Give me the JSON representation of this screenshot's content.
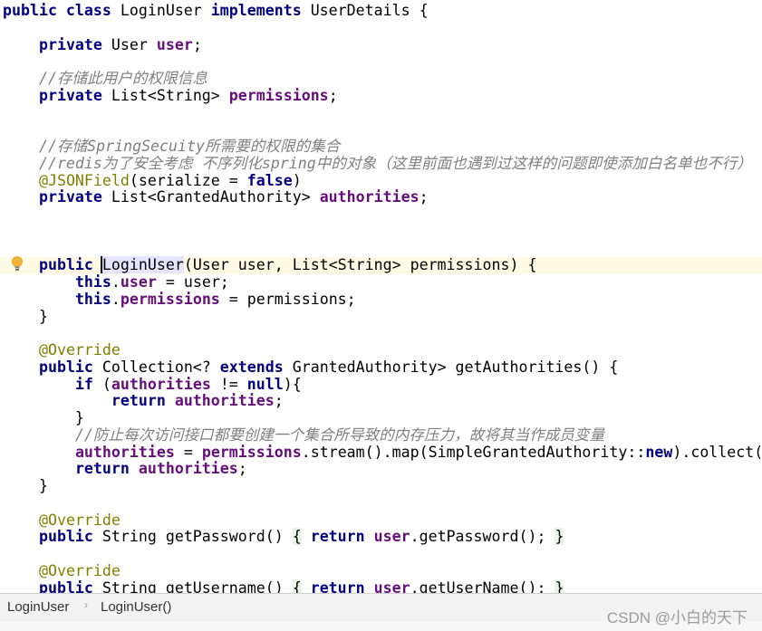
{
  "editor": {
    "current_line": 15,
    "lines": [
      [
        [
          "k",
          "public class "
        ],
        [
          "p",
          "LoginUser "
        ],
        [
          "k",
          "implements "
        ],
        [
          "p",
          "UserDetails {"
        ]
      ],
      [],
      [
        [
          "p",
          "    "
        ],
        [
          "k",
          "private "
        ],
        [
          "p",
          "User "
        ],
        [
          "f",
          "user"
        ],
        [
          "p",
          ";"
        ]
      ],
      [],
      [
        [
          "c",
          "    //存储此用户的权限信息"
        ]
      ],
      [
        [
          "p",
          "    "
        ],
        [
          "k",
          "private "
        ],
        [
          "p",
          "List<String> "
        ],
        [
          "f",
          "permissions"
        ],
        [
          "p",
          ";"
        ]
      ],
      [],
      [],
      [
        [
          "c",
          "    //存储SpringSecuity所需要的权限的集合"
        ]
      ],
      [
        [
          "c",
          "    //redis为了安全考虑 不序列化spring中的对象（这里前面也遇到过这样的问题即使添加白名单也不行）"
        ]
      ],
      [
        [
          "p",
          "    "
        ],
        [
          "a",
          "@JSONField"
        ],
        [
          "p",
          "(serialize = "
        ],
        [
          "k",
          "false"
        ],
        [
          "p",
          ")"
        ]
      ],
      [
        [
          "p",
          "    "
        ],
        [
          "k",
          "private "
        ],
        [
          "p",
          "List<GrantedAuthority> "
        ],
        [
          "f",
          "authorities"
        ],
        [
          "p",
          ";"
        ]
      ],
      [],
      [],
      [],
      [
        [
          "p",
          "    "
        ],
        [
          "k",
          "public "
        ],
        [
          "hl",
          "LoginUser"
        ],
        [
          "p",
          "(User user, List<String> permissions) {"
        ]
      ],
      [
        [
          "p",
          "        "
        ],
        [
          "k",
          "this"
        ],
        [
          "p",
          "."
        ],
        [
          "f",
          "user"
        ],
        [
          "p",
          " = user;"
        ]
      ],
      [
        [
          "p",
          "        "
        ],
        [
          "k",
          "this"
        ],
        [
          "p",
          "."
        ],
        [
          "f",
          "permissions"
        ],
        [
          "p",
          " = permissions;"
        ]
      ],
      [
        [
          "p",
          "    }"
        ]
      ],
      [],
      [
        [
          "p",
          "    "
        ],
        [
          "a",
          "@Override"
        ]
      ],
      [
        [
          "p",
          "    "
        ],
        [
          "k",
          "public "
        ],
        [
          "p",
          "Collection<? "
        ],
        [
          "k",
          "extends "
        ],
        [
          "p",
          "GrantedAuthority> getAuthorities() {"
        ]
      ],
      [
        [
          "p",
          "        "
        ],
        [
          "k",
          "if "
        ],
        [
          "p",
          "("
        ],
        [
          "f",
          "authorities"
        ],
        [
          "p",
          " != "
        ],
        [
          "k",
          "null"
        ],
        [
          "p",
          "){"
        ]
      ],
      [
        [
          "p",
          "            "
        ],
        [
          "k",
          "return "
        ],
        [
          "f",
          "authorities"
        ],
        [
          "p",
          ";"
        ]
      ],
      [
        [
          "p",
          "        }"
        ]
      ],
      [
        [
          "c",
          "        //防止每次访问接口都要创建一个集合所导致的内存压力，故将其当作成员变量"
        ]
      ],
      [
        [
          "p",
          "        "
        ],
        [
          "f",
          "authorities"
        ],
        [
          "p",
          " = "
        ],
        [
          "f",
          "permissions"
        ],
        [
          "p",
          ".stream().map(SimpleGrantedAuthority::"
        ],
        [
          "k",
          "new"
        ],
        [
          "p",
          ").collect(Collectors.toList());"
        ]
      ],
      [
        [
          "p",
          "        "
        ],
        [
          "k",
          "return "
        ],
        [
          "f",
          "authorities"
        ],
        [
          "p",
          ";"
        ]
      ],
      [
        [
          "p",
          "    }"
        ]
      ],
      [],
      [
        [
          "p",
          "    "
        ],
        [
          "a",
          "@Override"
        ]
      ],
      [
        [
          "p",
          "    "
        ],
        [
          "k",
          "public "
        ],
        [
          "p",
          "String getPassword() "
        ],
        [
          "fold",
          "{"
        ],
        [
          "p",
          " "
        ],
        [
          "k",
          "return "
        ],
        [
          "f",
          "user"
        ],
        [
          "p",
          ".getPassword(); "
        ],
        [
          "fold",
          "}"
        ]
      ],
      [],
      [
        [
          "p",
          "    "
        ],
        [
          "a",
          "@Override"
        ]
      ],
      [
        [
          "p",
          "    "
        ],
        [
          "k",
          "public "
        ],
        [
          "p",
          "String getUsername() "
        ],
        [
          "fold",
          "{"
        ],
        [
          "p",
          " "
        ],
        [
          "k",
          "return "
        ],
        [
          "f",
          "user"
        ],
        [
          "p",
          ".getUserName(); "
        ],
        [
          "fold",
          "}"
        ]
      ]
    ],
    "bulb_icon": "lightbulb-icon"
  },
  "breadcrumb": {
    "items": [
      "LoginUser",
      "LoginUser()"
    ],
    "separator_icon": "chevron-right-icon"
  },
  "watermark": "CSDN @小白的天下",
  "colors": {
    "keyword": "#000080",
    "field": "#660e7a",
    "comment": "#808080",
    "annotation": "#808000",
    "current_line": "#fffae3"
  }
}
